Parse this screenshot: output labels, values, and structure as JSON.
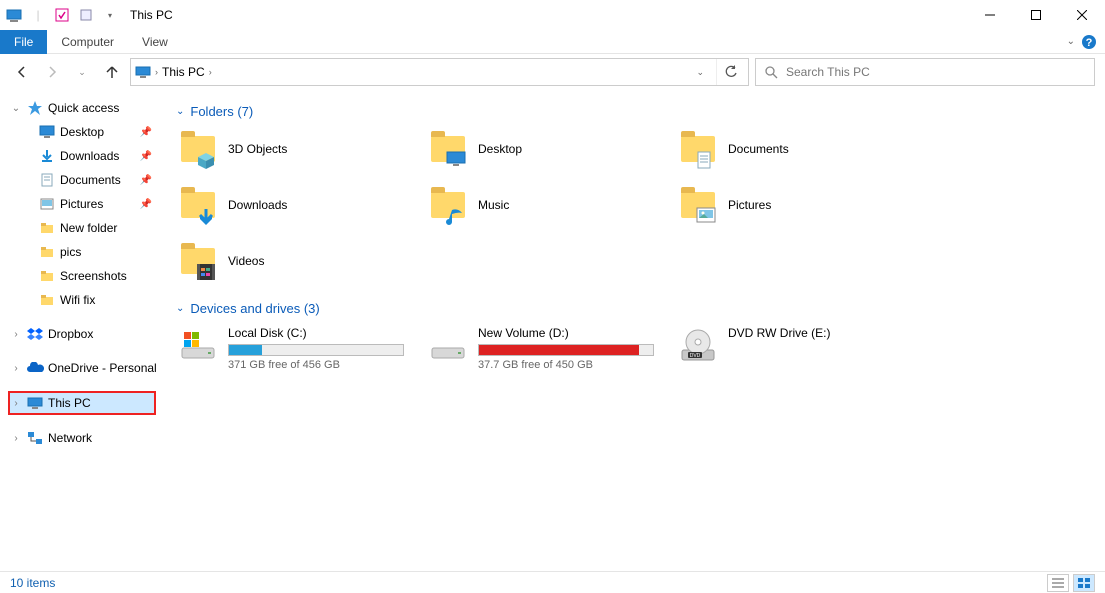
{
  "window": {
    "title": "This PC"
  },
  "ribbon": {
    "file": "File",
    "tabs": [
      "Computer",
      "View"
    ]
  },
  "address": {
    "crumbs": [
      "This PC"
    ]
  },
  "search": {
    "placeholder": "Search This PC"
  },
  "sidebar": {
    "quick_access": {
      "label": "Quick access",
      "items": [
        {
          "label": "Desktop",
          "pinned": true
        },
        {
          "label": "Downloads",
          "pinned": true
        },
        {
          "label": "Documents",
          "pinned": true
        },
        {
          "label": "Pictures",
          "pinned": true
        },
        {
          "label": "New folder",
          "pinned": false
        },
        {
          "label": "pics",
          "pinned": false
        },
        {
          "label": "Screenshots",
          "pinned": false
        },
        {
          "label": "Wifi fix",
          "pinned": false
        }
      ]
    },
    "roots": [
      {
        "label": "Dropbox"
      },
      {
        "label": "OneDrive - Personal"
      },
      {
        "label": "This PC",
        "selected": true
      },
      {
        "label": "Network"
      }
    ]
  },
  "sections": {
    "folders": {
      "title": "Folders (7)",
      "items": [
        {
          "label": "3D Objects",
          "overlay": "3d"
        },
        {
          "label": "Desktop",
          "overlay": "desktop"
        },
        {
          "label": "Documents",
          "overlay": "doc"
        },
        {
          "label": "Downloads",
          "overlay": "down"
        },
        {
          "label": "Music",
          "overlay": "music"
        },
        {
          "label": "Pictures",
          "overlay": "pic"
        },
        {
          "label": "Videos",
          "overlay": "video"
        }
      ]
    },
    "drives": {
      "title": "Devices and drives (3)",
      "items": [
        {
          "label": "Local Disk (C:)",
          "free_text": "371 GB free of 456 GB",
          "fill_pct": 19,
          "fill_color": "#26a0da",
          "icon": "disk-win"
        },
        {
          "label": "New Volume (D:)",
          "free_text": "37.7 GB free of 450 GB",
          "fill_pct": 92,
          "fill_color": "#d22",
          "icon": "disk"
        },
        {
          "label": "DVD RW Drive (E:)",
          "free_text": "",
          "fill_pct": null,
          "icon": "dvd"
        }
      ]
    }
  },
  "status": {
    "text": "10 items"
  }
}
